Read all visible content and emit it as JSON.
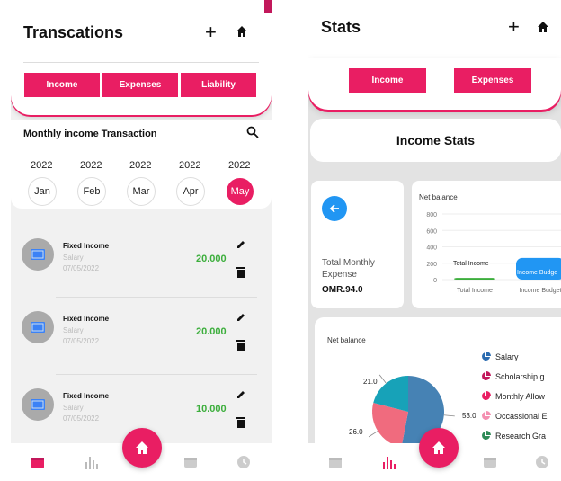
{
  "left": {
    "title": "Transcations",
    "tabs": [
      "Income",
      "Expenses",
      "Liability"
    ],
    "section_title": "Monthly income Transaction",
    "months": [
      {
        "year": "2022",
        "month": "Jan"
      },
      {
        "year": "2022",
        "month": "Feb"
      },
      {
        "year": "2022",
        "month": "Mar"
      },
      {
        "year": "2022",
        "month": "Apr"
      },
      {
        "year": "2022",
        "month": "May"
      }
    ],
    "transactions": [
      {
        "title": "Fixed Income",
        "category": "Salary",
        "date": "07/05/2022",
        "amount": "20.000"
      },
      {
        "title": "Fixed Income",
        "category": "Salary",
        "date": "07/05/2022",
        "amount": "20.000"
      },
      {
        "title": "Fixed Income",
        "category": "Salary",
        "date": "07/05/2022",
        "amount": "10.000"
      }
    ]
  },
  "right": {
    "title": "Stats",
    "tabs": [
      "Income",
      "Expenses"
    ],
    "section_title": "Income Stats",
    "summary": {
      "label_line1": "Total Monthly",
      "label_line2": "Expense",
      "value": "OMR.94.0"
    },
    "bar_chart_title": "Net balance",
    "pie_chart_title": "Net balance",
    "legend": [
      {
        "label": "Salary",
        "color": "#2b6cb0"
      },
      {
        "label": "Scholarship g",
        "color": "#c2185b"
      },
      {
        "label": "Monthly Allow",
        "color": "#e91e63"
      },
      {
        "label": "Occassional E",
        "color": "#f48fb1"
      },
      {
        "label": "Research Gra",
        "color": "#2e8b57"
      }
    ]
  },
  "colors": {
    "accent": "#e91e63",
    "positive": "#3cae3c",
    "bar_blue": "#2196f3",
    "pie_blue": "#4682b4",
    "pie_teal": "#17a2b8",
    "pie_pink": "#f06b7e"
  },
  "chart_data": [
    {
      "type": "bar",
      "title": "Net balance",
      "categories": [
        "Total Income",
        "Income Budget"
      ],
      "series": [
        {
          "values": [
            20,
            265
          ]
        }
      ],
      "bar_labels": [
        "Total Income",
        "Income Budge"
      ],
      "yticks": [
        0,
        200,
        400,
        600,
        800
      ],
      "ylim": [
        0,
        800
      ]
    },
    {
      "type": "pie",
      "title": "Net balance",
      "slice_labels": [
        "53.0",
        "26.0",
        "21.0"
      ],
      "values": [
        53,
        26,
        21
      ],
      "colors": [
        "#4682b4",
        "#f06b7e",
        "#17a2b8"
      ]
    }
  ]
}
